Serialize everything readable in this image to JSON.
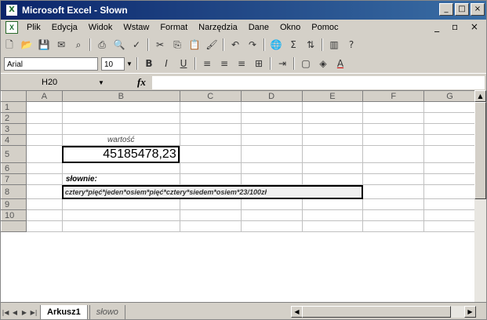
{
  "window": {
    "title": "Microsoft Excel - Słown",
    "controls": [
      "_",
      "□",
      "×"
    ]
  },
  "menu": {
    "items": [
      "Plik",
      "Edycja",
      "Widok",
      "Wstaw",
      "Format",
      "Narzędzia",
      "Dane",
      "Okno",
      "Pomoc"
    ],
    "doc_controls": "_ ▫ ×"
  },
  "format_toolbar": {
    "font": "Arial",
    "size": "10"
  },
  "name_box": "H20",
  "fx_label": "fx",
  "columns": [
    "A",
    "B",
    "C",
    "D",
    "E",
    "F",
    "G"
  ],
  "rows": [
    "1",
    "2",
    "3",
    "4",
    "5",
    "6",
    "7",
    "8",
    "9",
    "10"
  ],
  "cells": {
    "B4": "wartość",
    "B5": "45185478,23",
    "B7": "słownie:",
    "B8": "cztery*pięć*jeden*osiem*pięć*cztery*siedem*osiem*23/100zł"
  },
  "tabs": [
    "Arkusz1",
    "słowo"
  ]
}
